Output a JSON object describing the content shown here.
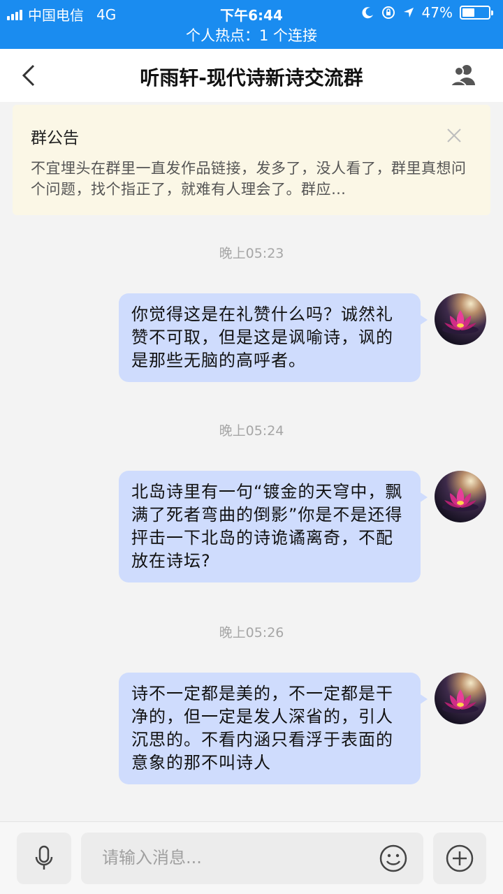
{
  "status_bar": {
    "carrier": "中国电信",
    "network": "4G",
    "time": "下午6:44",
    "battery_percent": "47%",
    "battery_level": 0.47
  },
  "hotspot_banner": "个人热点：1 个连接",
  "nav": {
    "title": "听雨轩-现代诗新诗交流群"
  },
  "announcement": {
    "title": "群公告",
    "body": "不宜埋头在群里一直发作品链接，发多了，没人看了，群里真想问个问题，找个指正了，就难有人理会了。群应…"
  },
  "messages": [
    {
      "time": "晚上05:23",
      "text": "你觉得这是在礼赞什么吗？诚然礼赞不可取，但是这是讽喻诗，讽的是那些无脑的高呼者。"
    },
    {
      "time": "晚上05:24",
      "text": "北岛诗里有一句“镀金的天穹中，飘满了死者弯曲的倒影”你是不是还得抨击一下北岛的诗诡谲离奇，不配放在诗坛?"
    },
    {
      "time": "晚上05:26",
      "text": "诗不一定都是美的，不一定都是干净的，但一定是发人深省的，引人沉思的。不看内涵只看浮于表面的意象的那不叫诗人"
    }
  ],
  "input": {
    "placeholder": "请输入消息..."
  },
  "colors": {
    "status_bar": "#1a8cf0",
    "bubble": "#cfdcfd",
    "announcement_bg": "#fbf7e6"
  }
}
